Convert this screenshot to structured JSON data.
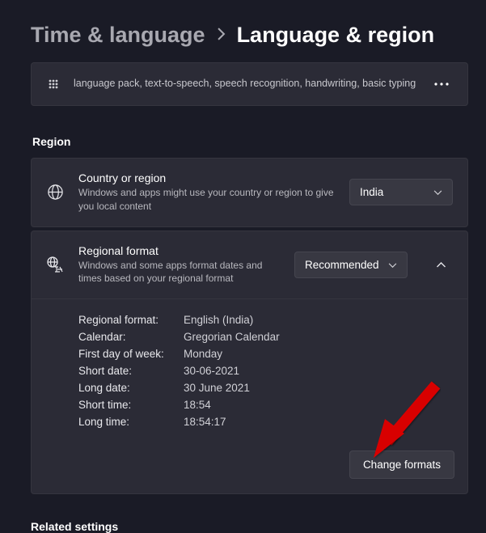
{
  "breadcrumb": {
    "parent": "Time & language",
    "current": "Language & region"
  },
  "lang_pack": {
    "desc": "language pack, text-to-speech, speech recognition, handwriting, basic typing"
  },
  "sections": {
    "region": "Region",
    "related": "Related settings"
  },
  "country": {
    "title": "Country or region",
    "desc": "Windows and apps might use your country or region to give you local content",
    "selected": "India"
  },
  "regional": {
    "title": "Regional format",
    "desc": "Windows and some apps format dates and times based on your regional format",
    "selected": "Recommended"
  },
  "details": {
    "labels": {
      "format": "Regional format:",
      "calendar": "Calendar:",
      "firstday": "First day of week:",
      "shortdate": "Short date:",
      "longdate": "Long date:",
      "shorttime": "Short time:",
      "longtime": "Long time:"
    },
    "values": {
      "format": "English (India)",
      "calendar": "Gregorian Calendar",
      "firstday": "Monday",
      "shortdate": "30-06-2021",
      "longdate": "30 June 2021",
      "shorttime": "18:54",
      "longtime": "18:54:17"
    }
  },
  "buttons": {
    "change_formats": "Change formats"
  }
}
